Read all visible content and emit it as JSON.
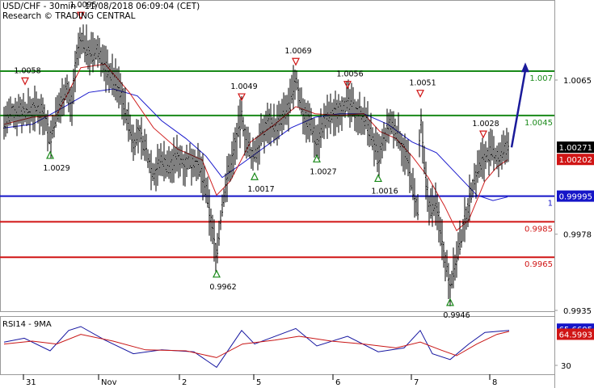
{
  "header": {
    "title": "USD/CHF - 30min - 11/08/2018 06:09:04 (CET)",
    "subtitle": "Research © TRADING CENTRAL"
  },
  "chart_data": [
    {
      "type": "line",
      "name": "price-panel",
      "y_axis": {
        "ticks": [
          1.0065,
          0.9978,
          0.9935
        ],
        "ylim": [
          0.9928,
          1.0098
        ]
      },
      "x_axis": {
        "tick_labels": [
          "31",
          "Nov",
          "2",
          "5",
          "6",
          "7",
          "8"
        ]
      },
      "levels": [
        {
          "value": 1.007,
          "label": "1.007",
          "color": "#1a8a1a"
        },
        {
          "value": 1.0045,
          "label": "1.0045",
          "color": "#1a8a1a"
        },
        {
          "value": 0.99995,
          "label": "1",
          "color": "#1515c8"
        },
        {
          "value": 0.9985,
          "label": "0.9985",
          "color": "#d01515"
        },
        {
          "value": 0.9965,
          "label": "0.9965",
          "color": "#d01515"
        }
      ],
      "price_badges": [
        {
          "value": 1.00271,
          "label": "1.00271",
          "color": "#000000"
        },
        {
          "value": 1.00202,
          "label": "1.00202",
          "color": "#d01515"
        },
        {
          "value": 0.99995,
          "label": "0.99995",
          "color": "#1515c8"
        }
      ],
      "pivots": [
        {
          "label": "1.0058",
          "kind": "high",
          "t": 31,
          "value": 1.0058
        },
        {
          "label": "1.0029",
          "kind": "low",
          "t": 62,
          "value": 1.0029
        },
        {
          "label": "1.0095",
          "kind": "high",
          "t": 100,
          "value": 1.0095
        },
        {
          "label": "0.9962",
          "kind": "low",
          "t": 268,
          "value": 0.9962
        },
        {
          "label": "1.0049",
          "kind": "high",
          "t": 299,
          "value": 1.0049
        },
        {
          "label": "1.0017",
          "kind": "low",
          "t": 315,
          "value": 1.0017
        },
        {
          "label": "1.0069",
          "kind": "high",
          "t": 366,
          "value": 1.0069
        },
        {
          "label": "1.0027",
          "kind": "low",
          "t": 392,
          "value": 1.0027
        },
        {
          "label": "1.0056",
          "kind": "high",
          "t": 430,
          "value": 1.0056
        },
        {
          "label": "1.0016",
          "kind": "low",
          "t": 468,
          "value": 1.0016
        },
        {
          "label": "1.0051",
          "kind": "high",
          "t": 520,
          "value": 1.0051
        },
        {
          "label": "0.9946",
          "kind": "low",
          "t": 557,
          "value": 0.9946
        },
        {
          "label": "1.0028",
          "kind": "high",
          "t": 598,
          "value": 1.0028
        }
      ],
      "projection": {
        "from": {
          "t": 633,
          "value": 1.0027
        },
        "to": {
          "t": 650,
          "value": 1.0074
        },
        "color": "#1a1a9a"
      },
      "price_series": [
        {
          "t": 5,
          "value": 1.0041
        },
        {
          "t": 15,
          "value": 1.0046
        },
        {
          "t": 25,
          "value": 1.0048
        },
        {
          "t": 35,
          "value": 1.0047
        },
        {
          "t": 45,
          "value": 1.0049
        },
        {
          "t": 55,
          "value": 1.0046
        },
        {
          "t": 62,
          "value": 1.0031
        },
        {
          "t": 68,
          "value": 1.0042
        },
        {
          "t": 75,
          "value": 1.0052
        },
        {
          "t": 82,
          "value": 1.0062
        },
        {
          "t": 88,
          "value": 1.0048
        },
        {
          "t": 93,
          "value": 1.0072
        },
        {
          "t": 100,
          "value": 1.0088
        },
        {
          "t": 108,
          "value": 1.0082
        },
        {
          "t": 115,
          "value": 1.0079
        },
        {
          "t": 122,
          "value": 1.0082
        },
        {
          "t": 130,
          "value": 1.0072
        },
        {
          "t": 140,
          "value": 1.0066
        },
        {
          "t": 150,
          "value": 1.0058
        },
        {
          "t": 158,
          "value": 1.0042
        },
        {
          "t": 165,
          "value": 1.003
        },
        {
          "t": 172,
          "value": 1.0035
        },
        {
          "t": 180,
          "value": 1.0026
        },
        {
          "t": 190,
          "value": 1.0012
        },
        {
          "t": 200,
          "value": 1.002
        },
        {
          "t": 210,
          "value": 1.0016
        },
        {
          "t": 220,
          "value": 1.0022
        },
        {
          "t": 230,
          "value": 1.0018
        },
        {
          "t": 240,
          "value": 1.002
        },
        {
          "t": 250,
          "value": 1.0012
        },
        {
          "t": 256,
          "value": 1.0
        },
        {
          "t": 262,
          "value": 0.9982
        },
        {
          "t": 268,
          "value": 0.9966
        },
        {
          "t": 274,
          "value": 0.999
        },
        {
          "t": 280,
          "value": 1.0008
        },
        {
          "t": 287,
          "value": 1.002
        },
        {
          "t": 294,
          "value": 1.0035
        },
        {
          "t": 299,
          "value": 1.0044
        },
        {
          "t": 305,
          "value": 1.003
        },
        {
          "t": 311,
          "value": 1.0022
        },
        {
          "t": 317,
          "value": 1.0025
        },
        {
          "t": 325,
          "value": 1.0035
        },
        {
          "t": 333,
          "value": 1.0042
        },
        {
          "t": 341,
          "value": 1.0038
        },
        {
          "t": 350,
          "value": 1.0044
        },
        {
          "t": 358,
          "value": 1.005
        },
        {
          "t": 366,
          "value": 1.0066
        },
        {
          "t": 372,
          "value": 1.0052
        },
        {
          "t": 378,
          "value": 1.0044
        },
        {
          "t": 385,
          "value": 1.004
        },
        {
          "t": 392,
          "value": 1.003
        },
        {
          "t": 398,
          "value": 1.0038
        },
        {
          "t": 405,
          "value": 1.0044
        },
        {
          "t": 412,
          "value": 1.0045
        },
        {
          "t": 420,
          "value": 1.0049
        },
        {
          "t": 430,
          "value": 1.0052
        },
        {
          "t": 438,
          "value": 1.0048
        },
        {
          "t": 446,
          "value": 1.0046
        },
        {
          "t": 455,
          "value": 1.004
        },
        {
          "t": 462,
          "value": 1.003
        },
        {
          "t": 468,
          "value": 1.002
        },
        {
          "t": 475,
          "value": 1.003
        },
        {
          "t": 482,
          "value": 1.004
        },
        {
          "t": 490,
          "value": 1.0036
        },
        {
          "t": 498,
          "value": 1.0028
        },
        {
          "t": 505,
          "value": 1.0018
        },
        {
          "t": 512,
          "value": 1.0
        },
        {
          "t": 517,
          "value": 0.999
        },
        {
          "t": 520,
          "value": 1.0046
        },
        {
          "t": 526,
          "value": 1.001
        },
        {
          "t": 532,
          "value": 0.9992
        },
        {
          "t": 538,
          "value": 0.9995
        },
        {
          "t": 544,
          "value": 0.9985
        },
        {
          "t": 550,
          "value": 0.9966
        },
        {
          "t": 557,
          "value": 0.995
        },
        {
          "t": 563,
          "value": 0.996
        },
        {
          "t": 569,
          "value": 0.9972
        },
        {
          "t": 575,
          "value": 0.9985
        },
        {
          "t": 581,
          "value": 0.9998
        },
        {
          "t": 588,
          "value": 1.001
        },
        {
          "t": 594,
          "value": 1.0018
        },
        {
          "t": 600,
          "value": 1.0022
        },
        {
          "t": 608,
          "value": 1.0024
        },
        {
          "t": 616,
          "value": 1.0021
        },
        {
          "t": 624,
          "value": 1.0025
        },
        {
          "t": 630,
          "value": 1.0027
        }
      ],
      "ma_fast": [
        {
          "t": 5,
          "value": 1.004
        },
        {
          "t": 40,
          "value": 1.0044
        },
        {
          "t": 70,
          "value": 1.0045
        },
        {
          "t": 100,
          "value": 1.0072
        },
        {
          "t": 130,
          "value": 1.0074
        },
        {
          "t": 160,
          "value": 1.0058
        },
        {
          "t": 190,
          "value": 1.0038
        },
        {
          "t": 220,
          "value": 1.0026
        },
        {
          "t": 250,
          "value": 1.002
        },
        {
          "t": 268,
          "value": 1.0
        },
        {
          "t": 285,
          "value": 1.0008
        },
        {
          "t": 310,
          "value": 1.003
        },
        {
          "t": 340,
          "value": 1.004
        },
        {
          "t": 366,
          "value": 1.005
        },
        {
          "t": 390,
          "value": 1.0046
        },
        {
          "t": 420,
          "value": 1.0045
        },
        {
          "t": 450,
          "value": 1.0046
        },
        {
          "t": 470,
          "value": 1.0036
        },
        {
          "t": 490,
          "value": 1.0032
        },
        {
          "t": 510,
          "value": 1.0022
        },
        {
          "t": 530,
          "value": 1.001
        },
        {
          "t": 550,
          "value": 0.9994
        },
        {
          "t": 565,
          "value": 0.998
        },
        {
          "t": 580,
          "value": 0.9986
        },
        {
          "t": 600,
          "value": 1.0008
        },
        {
          "t": 615,
          "value": 1.0016
        },
        {
          "t": 628,
          "value": 1.002
        }
      ],
      "ma_slow": [
        {
          "t": 5,
          "value": 1.0038
        },
        {
          "t": 40,
          "value": 1.004
        },
        {
          "t": 80,
          "value": 1.005
        },
        {
          "t": 110,
          "value": 1.0058
        },
        {
          "t": 140,
          "value": 1.006
        },
        {
          "t": 170,
          "value": 1.0056
        },
        {
          "t": 200,
          "value": 1.0042
        },
        {
          "t": 230,
          "value": 1.0032
        },
        {
          "t": 255,
          "value": 1.0022
        },
        {
          "t": 275,
          "value": 1.001
        },
        {
          "t": 300,
          "value": 1.0018
        },
        {
          "t": 330,
          "value": 1.0028
        },
        {
          "t": 360,
          "value": 1.0038
        },
        {
          "t": 390,
          "value": 1.0044
        },
        {
          "t": 420,
          "value": 1.0046
        },
        {
          "t": 450,
          "value": 1.0046
        },
        {
          "t": 480,
          "value": 1.004
        },
        {
          "t": 510,
          "value": 1.003
        },
        {
          "t": 540,
          "value": 1.0024
        },
        {
          "t": 565,
          "value": 1.0012
        },
        {
          "t": 590,
          "value": 1.0
        },
        {
          "t": 610,
          "value": 0.9997
        },
        {
          "t": 628,
          "value": 0.9999
        }
      ]
    },
    {
      "type": "line",
      "name": "rsi-panel",
      "title": "RSI14 - 9MA",
      "y_axis": {
        "ticks": [
          30
        ],
        "ylim": [
          20,
          80
        ]
      },
      "badges": [
        {
          "value": 65.6605,
          "label": "65.6605",
          "color": "#1515c8"
        },
        {
          "value": 64.5993,
          "label": "64.5993",
          "color": "#d01515"
        }
      ],
      "series": [
        {
          "role": "rsi",
          "color": "#1515a0",
          "points": [
            {
              "t": 5,
              "value": 54
            },
            {
              "t": 30,
              "value": 58
            },
            {
              "t": 62,
              "value": 45
            },
            {
              "t": 85,
              "value": 66
            },
            {
              "t": 100,
              "value": 70
            },
            {
              "t": 130,
              "value": 56
            },
            {
              "t": 165,
              "value": 42
            },
            {
              "t": 200,
              "value": 46
            },
            {
              "t": 240,
              "value": 44
            },
            {
              "t": 268,
              "value": 28
            },
            {
              "t": 299,
              "value": 66
            },
            {
              "t": 315,
              "value": 52
            },
            {
              "t": 366,
              "value": 68
            },
            {
              "t": 392,
              "value": 50
            },
            {
              "t": 430,
              "value": 60
            },
            {
              "t": 468,
              "value": 44
            },
            {
              "t": 500,
              "value": 48
            },
            {
              "t": 520,
              "value": 66
            },
            {
              "t": 535,
              "value": 42
            },
            {
              "t": 557,
              "value": 36
            },
            {
              "t": 580,
              "value": 52
            },
            {
              "t": 600,
              "value": 64
            },
            {
              "t": 630,
              "value": 66
            }
          ]
        },
        {
          "role": "rsi_ma",
          "color": "#c81515",
          "points": [
            {
              "t": 5,
              "value": 52
            },
            {
              "t": 40,
              "value": 55
            },
            {
              "t": 70,
              "value": 52
            },
            {
              "t": 100,
              "value": 62
            },
            {
              "t": 140,
              "value": 55
            },
            {
              "t": 180,
              "value": 46
            },
            {
              "t": 230,
              "value": 45
            },
            {
              "t": 268,
              "value": 38
            },
            {
              "t": 300,
              "value": 52
            },
            {
              "t": 340,
              "value": 56
            },
            {
              "t": 370,
              "value": 60
            },
            {
              "t": 410,
              "value": 55
            },
            {
              "t": 450,
              "value": 52
            },
            {
              "t": 490,
              "value": 48
            },
            {
              "t": 520,
              "value": 54
            },
            {
              "t": 545,
              "value": 46
            },
            {
              "t": 565,
              "value": 40
            },
            {
              "t": 590,
              "value": 52
            },
            {
              "t": 615,
              "value": 62
            },
            {
              "t": 630,
              "value": 65
            }
          ]
        }
      ]
    }
  ]
}
